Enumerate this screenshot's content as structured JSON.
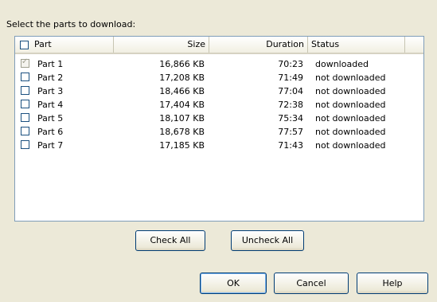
{
  "prompt_text": "Select the parts to download:",
  "columns": {
    "part": "Part",
    "size": "Size",
    "duration": "Duration",
    "status": "Status"
  },
  "select_all_checked": false,
  "rows": [
    {
      "part": "Part 1",
      "size": "16,866 KB",
      "duration": "70:23",
      "status": "downloaded",
      "checked": true
    },
    {
      "part": "Part 2",
      "size": "17,208 KB",
      "duration": "71:49",
      "status": "not downloaded",
      "checked": false
    },
    {
      "part": "Part 3",
      "size": "18,466 KB",
      "duration": "77:04",
      "status": "not downloaded",
      "checked": false
    },
    {
      "part": "Part 4",
      "size": "17,404 KB",
      "duration": "72:38",
      "status": "not downloaded",
      "checked": false
    },
    {
      "part": "Part 5",
      "size": "18,107 KB",
      "duration": "75:34",
      "status": "not downloaded",
      "checked": false
    },
    {
      "part": "Part 6",
      "size": "18,678 KB",
      "duration": "77:57",
      "status": "not downloaded",
      "checked": false
    },
    {
      "part": "Part 7",
      "size": "17,185 KB",
      "duration": "71:43",
      "status": "not downloaded",
      "checked": false
    }
  ],
  "buttons": {
    "check_all": "Check All",
    "uncheck_all": "Uncheck All",
    "ok": "OK",
    "cancel": "Cancel",
    "help": "Help"
  }
}
